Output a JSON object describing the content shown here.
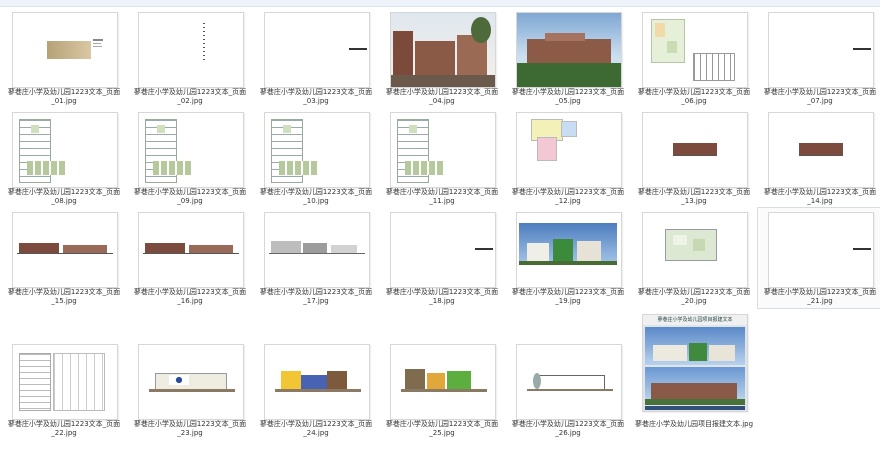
{
  "files": [
    {
      "name": "蓼巷庄小学及幼儿园1223文本_页面_01.jpg",
      "kind": "cover"
    },
    {
      "name": "蓼巷庄小学及幼儿园1223文本_页面_02.jpg",
      "kind": "text"
    },
    {
      "name": "蓼巷庄小学及幼儿园1223文本_页面_03.jpg",
      "kind": "blank-bar"
    },
    {
      "name": "蓼巷庄小学及幼儿园1223文本_页面_04.jpg",
      "kind": "photo-street"
    },
    {
      "name": "蓼巷庄小学及幼儿园1223文本_页面_05.jpg",
      "kind": "photo-campus"
    },
    {
      "name": "蓼巷庄小学及幼儿园1223文本_页面_06.jpg",
      "kind": "siteplan"
    },
    {
      "name": "蓼巷庄小学及幼儿园1223文本_页面_07.jpg",
      "kind": "blank-bar"
    },
    {
      "name": "蓼巷庄小学及幼儿园1223文本_页面_08.jpg",
      "kind": "floorplan"
    },
    {
      "name": "蓼巷庄小学及幼儿园1223文本_页面_09.jpg",
      "kind": "floorplan"
    },
    {
      "name": "蓼巷庄小学及幼儿园1223文本_页面_10.jpg",
      "kind": "floorplan"
    },
    {
      "name": "蓼巷庄小学及幼儿园1223文本_页面_11.jpg",
      "kind": "floorplan"
    },
    {
      "name": "蓼巷庄小学及幼儿园1223文本_页面_12.jpg",
      "kind": "colorplan"
    },
    {
      "name": "蓼巷庄小学及幼儿园1223文本_页面_13.jpg",
      "kind": "elevation-small"
    },
    {
      "name": "蓼巷庄小学及幼儿园1223文本_页面_14.jpg",
      "kind": "elevation-small"
    },
    {
      "name": "蓼巷庄小学及幼儿园1223文本_页面_15.jpg",
      "kind": "elevation-long"
    },
    {
      "name": "蓼巷庄小学及幼儿园1223文本_页面_16.jpg",
      "kind": "elevation-long"
    },
    {
      "name": "蓼巷庄小学及幼儿园1223文本_页面_17.jpg",
      "kind": "elevation-grey"
    },
    {
      "name": "蓼巷庄小学及幼儿园1223文本_页面_18.jpg",
      "kind": "blank-bar"
    },
    {
      "name": "蓼巷庄小学及幼儿园1223文本_页面_19.jpg",
      "kind": "photo-kinder"
    },
    {
      "name": "蓼巷庄小学及幼儿园1223文本_页面_20.jpg",
      "kind": "siteplan-green"
    },
    {
      "name": "蓼巷庄小学及幼儿园1223文本_页面_21.jpg",
      "kind": "blank-bar"
    },
    {
      "name": "蓼巷庄小学及幼儿园1223文本_页面_22.jpg",
      "kind": "floorplan-outline"
    },
    {
      "name": "蓼巷庄小学及幼儿园1223文本_页面_23.jpg",
      "kind": "kinder-elev-a"
    },
    {
      "name": "蓼巷庄小学及幼儿园1223文本_页面_24.jpg",
      "kind": "kinder-elev-b"
    },
    {
      "name": "蓼巷庄小学及幼儿园1223文本_页面_25.jpg",
      "kind": "kinder-elev-c"
    },
    {
      "name": "蓼巷庄小学及幼儿园1223文本_页面_26.jpg",
      "kind": "section"
    },
    {
      "name": "蓼巷庄小学及幼儿园项目报建文本.jpg",
      "kind": "poster",
      "poster_title": "蓼巷庄小学及幼儿园项目报建文本"
    }
  ],
  "selected_index": 20
}
